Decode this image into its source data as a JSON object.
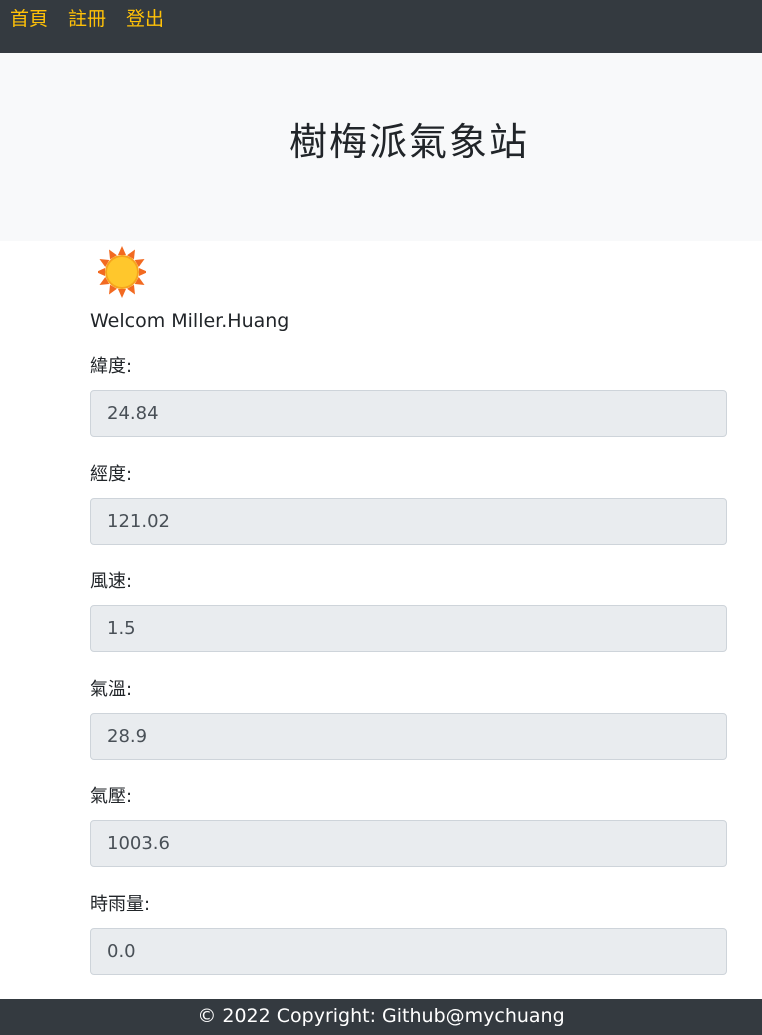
{
  "nav": {
    "items": [
      "首頁",
      "註冊",
      "登出"
    ]
  },
  "header": {
    "title": "樹梅派氣象站"
  },
  "weather_icon": "sun-icon",
  "welcome": "Welcom Miller.Huang",
  "fields": [
    {
      "label": "緯度:",
      "value": "24.84"
    },
    {
      "label": "經度:",
      "value": "121.02"
    },
    {
      "label": "風速:",
      "value": "1.5"
    },
    {
      "label": "氣溫:",
      "value": "28.9"
    },
    {
      "label": "氣壓:",
      "value": "1003.6"
    },
    {
      "label": "時雨量:",
      "value": "0.0"
    }
  ],
  "footer": {
    "text": "© 2022 Copyright: Github@mychuang"
  },
  "colors": {
    "navbar_bg": "#343a40",
    "nav_link": "#ffc107",
    "jumbotron_bg": "#f8f9fa",
    "input_bg": "#e9ecef"
  }
}
